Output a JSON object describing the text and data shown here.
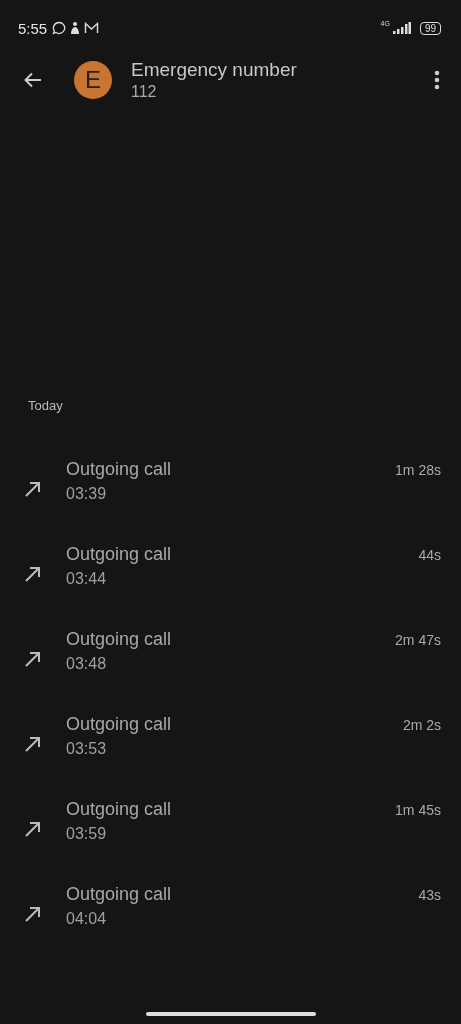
{
  "status_bar": {
    "time": "5:55",
    "network": "4G",
    "battery": "99"
  },
  "contact": {
    "initial": "E",
    "name": "Emergency number",
    "number": "112"
  },
  "section": "Today",
  "calls": [
    {
      "kind": "outgoing",
      "label": "Outgoing call",
      "time": "03:39",
      "duration": "1m 28s"
    },
    {
      "kind": "outgoing",
      "label": "Outgoing call",
      "time": "03:44",
      "duration": "44s"
    },
    {
      "kind": "outgoing",
      "label": "Outgoing call",
      "time": "03:48",
      "duration": "2m 47s"
    },
    {
      "kind": "outgoing",
      "label": "Outgoing call",
      "time": "03:53",
      "duration": "2m 2s"
    },
    {
      "kind": "outgoing",
      "label": "Outgoing call",
      "time": "03:59",
      "duration": "1m 45s"
    },
    {
      "kind": "outgoing",
      "label": "Outgoing call",
      "time": "04:04",
      "duration": "43s"
    }
  ]
}
